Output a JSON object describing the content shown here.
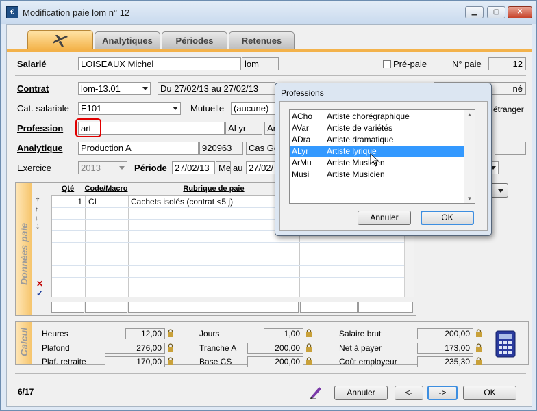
{
  "window": {
    "title": "Modification paie lom n° 12",
    "icon_letter": "€"
  },
  "tabs": [
    {
      "label": ""
    },
    {
      "label": "Analytiques"
    },
    {
      "label": "Périodes"
    },
    {
      "label": "Retenues"
    }
  ],
  "header": {
    "salarie_label": "Salarié",
    "salarie_name": "LOISEAUX Michel",
    "salarie_code": "lom",
    "prepaie_label": "Pré-paie",
    "num_paie_label": "N° paie",
    "num_paie_value": "12",
    "contrat_label": "Contrat",
    "contrat_value": "lom-13.01",
    "contrat_period": "Du 27/02/13 au 27/02/13",
    "contrat_extra": "né",
    "cat_label": "Cat. salariale",
    "cat_value": "E101",
    "mutuelle_label": "Mutuelle",
    "mutuelle_value": "(aucune)",
    "etranger_label": "étranger",
    "profession_label": "Profession",
    "profession_value": "art",
    "profession_code": "ALyr",
    "profession_code2": "Ar",
    "analytique_label": "Analytique",
    "analytique_value": "Production A",
    "analytique_code": "920963",
    "analytique_extra": "Cas Ge",
    "exercice_label": "Exercice",
    "exercice_value": "2013",
    "periode_label": "Période",
    "periode_start": "27/02/13",
    "periode_day": "Me",
    "periode_au": "au",
    "periode_end": "27/02/"
  },
  "donnees": {
    "band_label": "Données paie",
    "columns": [
      "Qté",
      "Code/Macro",
      "Rubrique de paie"
    ],
    "rows": [
      {
        "qte": "1",
        "code": "CI",
        "rubrique": "Cachets isolés (contrat <5 j)"
      }
    ]
  },
  "calcul": {
    "band_label": "Calcul",
    "heures_label": "Heures",
    "heures_value": "12,00",
    "plafond_label": "Plafond",
    "plafond_value": "276,00",
    "plaf_retraite_label": "Plaf. retraite",
    "plaf_retraite_value": "170,00",
    "jours_label": "Jours",
    "jours_value": "1,00",
    "tranche_a_label": "Tranche A",
    "tranche_a_value": "200,00",
    "base_cs_label": "Base CS",
    "base_cs_value": "200,00",
    "salaire_brut_label": "Salaire brut",
    "salaire_brut_value": "200,00",
    "net_label": "Net à payer",
    "net_value": "173,00",
    "cout_label": "Coût employeur",
    "cout_value": "235,30"
  },
  "footer": {
    "counter": "6/17",
    "annuler": "Annuler",
    "prev": "<-",
    "next": "->",
    "ok": "OK"
  },
  "dialog": {
    "title": "Professions",
    "items": [
      {
        "code": "ACho",
        "label": "Artiste chorégraphique"
      },
      {
        "code": "AVar",
        "label": "Artiste de variétés"
      },
      {
        "code": "ADra",
        "label": "Artiste dramatique"
      },
      {
        "code": "ALyr",
        "label": "Artiste lyrique"
      },
      {
        "code": "ArMu",
        "label": "Artiste Musicien"
      },
      {
        "code": "Musi",
        "label": "Artiste Musicien"
      }
    ],
    "selected_index": 3,
    "annuler": "Annuler",
    "ok": "OK"
  },
  "colors": {
    "accent_orange": "#f3b24b",
    "selection_blue": "#3399ff",
    "highlight_red": "#e00000"
  }
}
